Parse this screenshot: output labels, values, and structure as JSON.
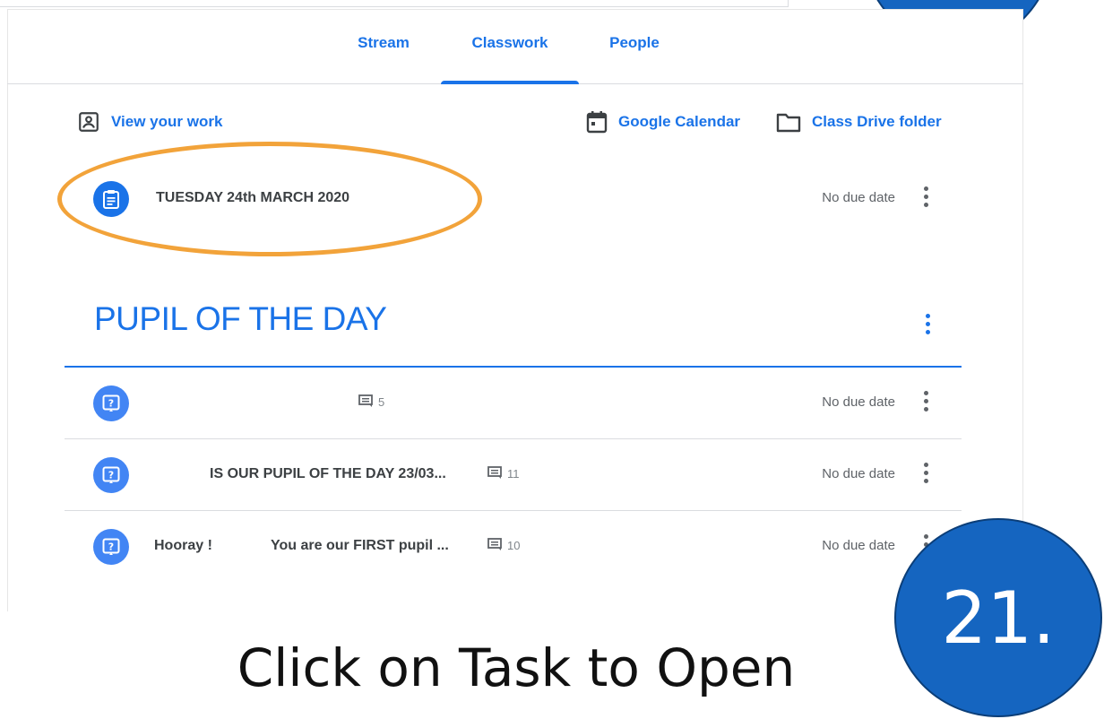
{
  "tabs": [
    {
      "label": "Stream"
    },
    {
      "label": "Classwork",
      "active": true
    },
    {
      "label": "People"
    }
  ],
  "toolbar": {
    "view_work": "View your work",
    "calendar": "Google Calendar",
    "drive": "Class Drive folder"
  },
  "featured_task": {
    "title": "TUESDAY 24th MARCH 2020",
    "due": "No due date",
    "icon": "assignment-icon"
  },
  "section": {
    "title": "PUPIL OF THE DAY"
  },
  "questions": [
    {
      "title": "",
      "comments": "5",
      "due": "No due date",
      "icon": "question-icon"
    },
    {
      "title": "IS OUR PUPIL OF THE DAY 23/03...",
      "comments": "11",
      "due": "No due date",
      "icon": "question-icon"
    },
    {
      "title_a": "Hooray !",
      "title_b": "You are our FIRST pupil ...",
      "comments": "10",
      "due": "No due date",
      "icon": "question-icon"
    }
  ],
  "caption": "Click on Task to Open",
  "step_number": "21.",
  "colors": {
    "accent": "#1a73e8",
    "annotation": "#f2a33a",
    "badge": "#1565c0"
  }
}
